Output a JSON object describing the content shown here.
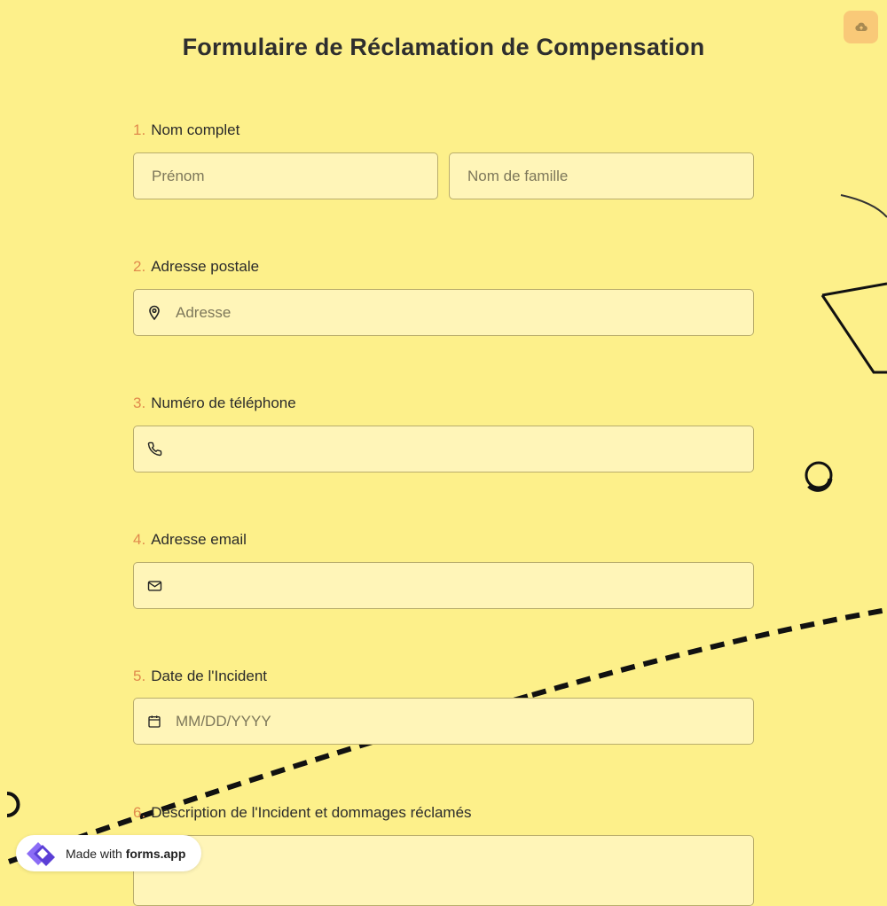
{
  "form": {
    "title": "Formulaire de Réclamation de Compensation",
    "questions": [
      {
        "number": "1.",
        "label": "Nom complet",
        "fields": [
          {
            "placeholder": "Prénom"
          },
          {
            "placeholder": "Nom de famille"
          }
        ]
      },
      {
        "number": "2.",
        "label": "Adresse postale",
        "placeholder": "Adresse",
        "icon": "location-pin-icon"
      },
      {
        "number": "3.",
        "label": "Numéro de téléphone",
        "placeholder": "",
        "icon": "phone-icon"
      },
      {
        "number": "4.",
        "label": "Adresse email",
        "placeholder": "",
        "icon": "mail-icon"
      },
      {
        "number": "5.",
        "label": "Date de l'Incident",
        "placeholder": "MM/DD/YYYY",
        "icon": "calendar-icon"
      },
      {
        "number": "6.",
        "label": "Description de l'Incident et dommages réclamés"
      }
    ]
  },
  "toolbar": {
    "save_icon": "cloud-upload-icon"
  },
  "badge": {
    "prefix": "Made with",
    "brand": "forms.app",
    "icon": "forms-app-logo-icon"
  },
  "colors": {
    "background": "#fdf08a",
    "field": "#fff5b8",
    "accent_number": "#e08a4c",
    "save_button": "#f9c978"
  }
}
